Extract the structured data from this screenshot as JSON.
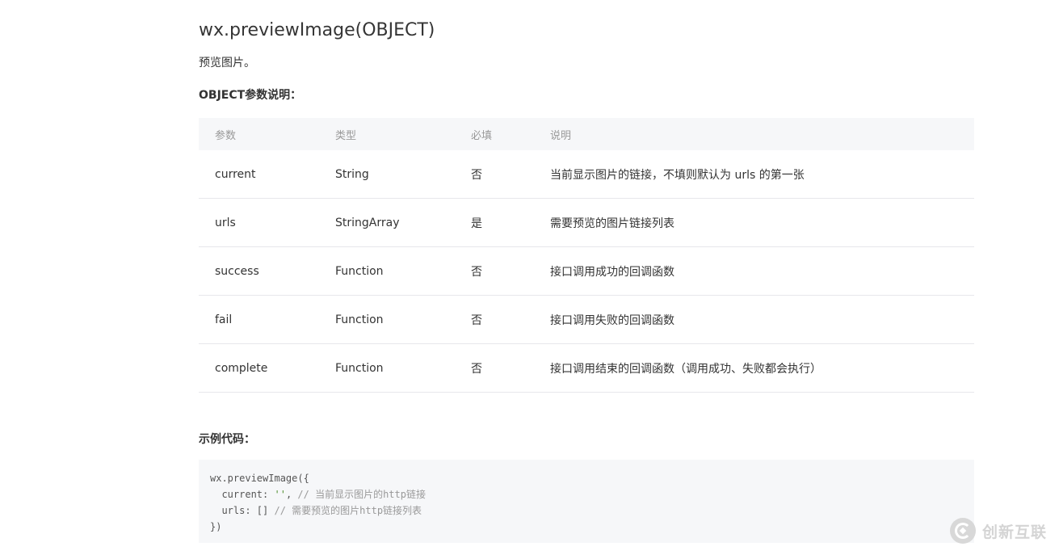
{
  "doc": {
    "title": "wx.previewImage(OBJECT)",
    "description": "预览图片。",
    "params_label": "OBJECT参数说明：",
    "example_label": "示例代码："
  },
  "params_table": {
    "headers": [
      "参数",
      "类型",
      "必填",
      "说明"
    ],
    "rows": [
      [
        "current",
        "String",
        "否",
        "当前显示图片的链接，不填则默认为 urls 的第一张"
      ],
      [
        "urls",
        "StringArray",
        "是",
        "需要预览的图片链接列表"
      ],
      [
        "success",
        "Function",
        "否",
        "接口调用成功的回调函数"
      ],
      [
        "fail",
        "Function",
        "否",
        "接口调用失败的回调函数"
      ],
      [
        "complete",
        "Function",
        "否",
        "接口调用结束的回调函数（调用成功、失败都会执行）"
      ]
    ]
  },
  "code_example": {
    "line1": "wx.previewImage({",
    "line2_key": "  current: ",
    "line2_value": "''",
    "line2_sep": ", ",
    "line2_comment": "// 当前显示图片的http链接",
    "line3_key": "  urls: [] ",
    "line3_comment": "// 需要预览的图片http链接列表",
    "line4": "})"
  },
  "watermark": {
    "text": "创新互联",
    "icon": "brand-logo-icon"
  },
  "colors": {
    "header_bg": "#f6f7f9",
    "row_border": "#e7e7eb",
    "code_bg": "#f6f7f9",
    "string": "#4f8f2f",
    "comment": "#999999"
  }
}
